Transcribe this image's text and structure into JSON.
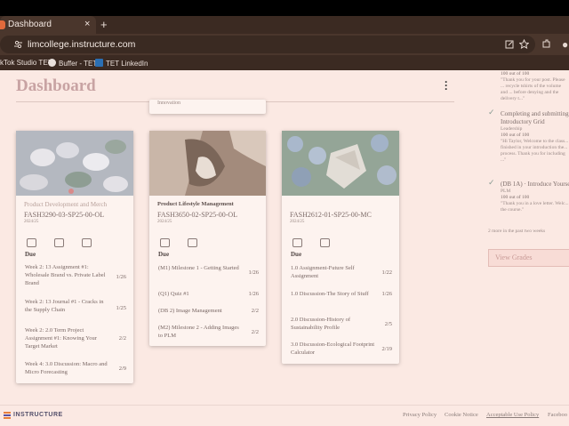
{
  "browser": {
    "tab_title": "Dashboard",
    "tab_close": "×",
    "new_tab": "+",
    "url": "limcollege.instructure.com",
    "bookmarks": [
      "kTok Studio TET",
      "Buffer - TET",
      "TET LinkedIn"
    ]
  },
  "page": {
    "title": "Dashboard"
  },
  "cards": [
    {
      "top_snippet": "",
      "meta": "Product Development and Merch",
      "code": "FASH3290-03-SP25-00-OL",
      "term": "2024/25",
      "due_label": "Due",
      "image_colors": [
        "#c9c9cf",
        "#9aa6a0",
        "#e8e4e6"
      ],
      "items": [
        {
          "title": "Week 2: 13 Assignment #1: Wholesale Brand vs. Private Label Brand",
          "date": "1/26"
        },
        {
          "title": "Week 2: 13 Journal #1 - Cracks in the Supply Chain",
          "date": "1/25"
        },
        {
          "title": "Week 2: 2.0 Term Project Assignment #1: Knowing Your Target Market",
          "date": "2/2"
        },
        {
          "title": "Week 4: 3.0 Discussion: Macro and Micro Forecasting",
          "date": "2/9"
        }
      ]
    },
    {
      "top_snippet": "Innovation",
      "meta": "Product Lifestyle Management",
      "code": "FASH3650-02-SP25-00-OL",
      "term": "2024/25",
      "due_label": "Due",
      "image_colors": [
        "#b89e8d",
        "#d8c6b8",
        "#8c7668"
      ],
      "items": [
        {
          "title": "(M1) Milestone 1 - Getting Started",
          "date": "1/26"
        },
        {
          "title": "(Q1) Quiz #1",
          "date": "1/26"
        },
        {
          "title": "(DB 2) Image Management",
          "date": "2/2"
        },
        {
          "title": "(M2) Milestone 2 - Adding Images to PLM",
          "date": "2/2"
        }
      ]
    },
    {
      "top_snippet": "",
      "meta": "",
      "code": "FASH2612-01-SP25-00-MC",
      "term": "2024/25",
      "due_label": "Due",
      "image_colors": [
        "#8ea2b8",
        "#a7b59c",
        "#d8d3cc"
      ],
      "items": [
        {
          "title": "1.0 Assignment-Future Self Assignment",
          "date": "1/22"
        },
        {
          "title": "1.0 Discussion-The Story of Stuff",
          "date": "1/26"
        },
        {
          "title": "2.0 Discussion-History of Sustainability Profile",
          "date": "2/5"
        },
        {
          "title": "3.0 Discussion-Ecological Footprint Calculator",
          "date": "2/19"
        }
      ]
    }
  ],
  "sidebar": {
    "feedback_top": {
      "score": "100 out of 100",
      "comment": "\"Thank you for your post. Please ... recycle tshirts of the volume and ... before denying and the delivery t...\""
    },
    "feedback_items": [
      {
        "title": "Completing and submitting Introductory Grid",
        "course": "Leadership",
        "score": "100 out of 100",
        "comment": "\"Hi Taylor, Welcome to the class... finished in your introduction the... process. Thank you for including ...\""
      },
      {
        "title": "(DB 1A) · Introduce Yourself",
        "course": "PLM",
        "score": "100 out of 100",
        "comment": "\"Thank you in a love letter. Welc... the course.\""
      }
    ],
    "note": "2 more in the past two weeks",
    "view_grades": "View Grades"
  },
  "footer": {
    "brand": "INSTRUCTURE",
    "links": [
      "Privacy Policy",
      "Cookie Notice",
      "Acceptable Use Policy",
      "Faceboo"
    ]
  }
}
